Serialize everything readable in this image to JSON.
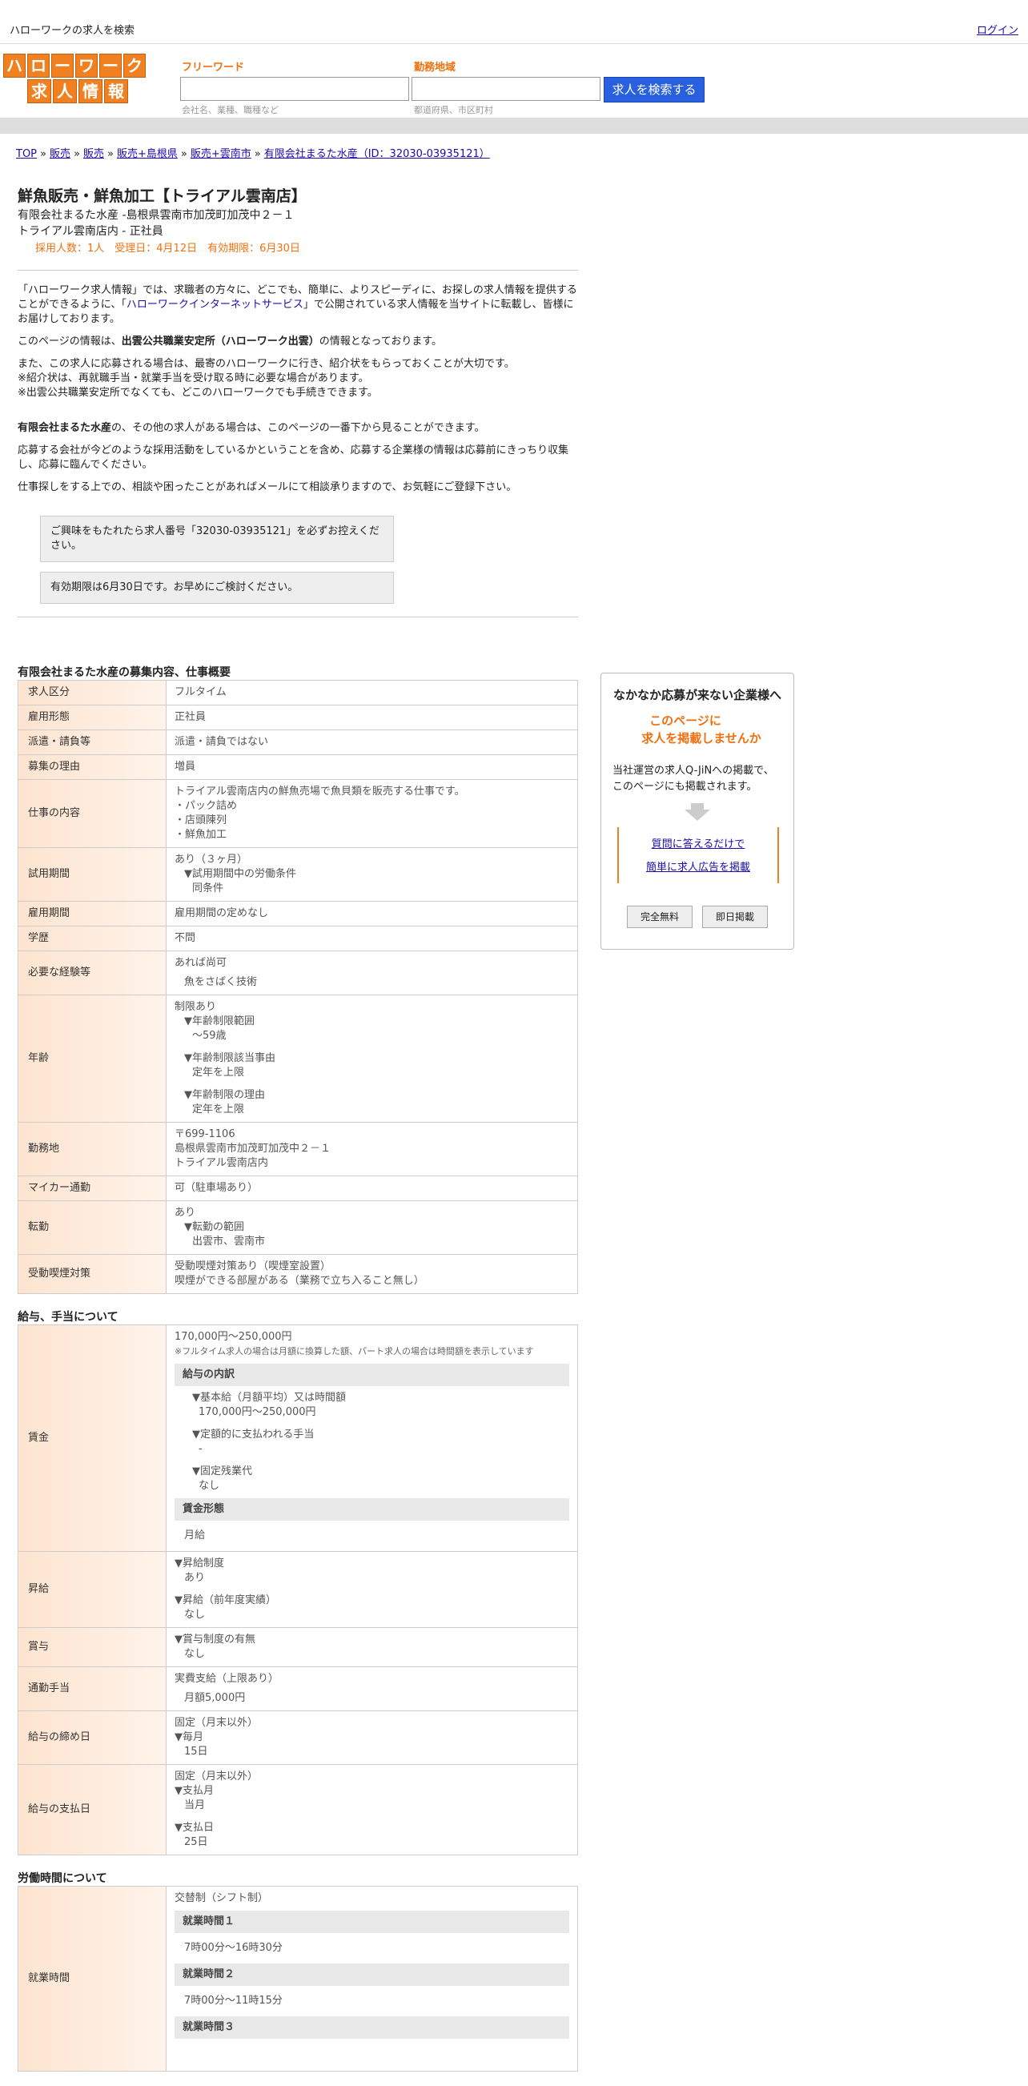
{
  "topbar": {
    "site_title": "ハローワークの求人を検索",
    "login": "ログイン"
  },
  "logo": {
    "row1": [
      "ハ",
      "ロ",
      "ー",
      "ワ",
      "ー",
      "ク"
    ],
    "row2": [
      "求",
      "人",
      "情",
      "報"
    ]
  },
  "search": {
    "freeword_label": "フリーワード",
    "freeword_hint": "会社名、業種、職種など",
    "area_label": "勤務地域",
    "area_hint": "都道府県、市区町村",
    "button": "求人を検索する"
  },
  "breadcrumb": [
    "TOP",
    "販売",
    "販売",
    "販売+島根県",
    "販売+雲南市",
    "有限会社まるた水産（ID：32030-03935121）"
  ],
  "job": {
    "title": "鮮魚販売・鮮魚加工【トライアル雲南店】",
    "company_line": "有限会社まるた水産 -島根県雲南市加茂町加茂中２－１",
    "store_line": "トライアル雲南店内 - 正社員",
    "meta": "採用人数：1人　受理日：4月12日　有効期限：6月30日"
  },
  "intro": {
    "p1a": "「ハローワーク求人情報」では、求職者の方々に、どこでも、簡単に、よりスピーディに、お探しの求人情報を提供することができるように、「",
    "p1_link": "ハローワークインターネットサービス",
    "p1b": "」で公開されている求人情報を当サイトに転載し、皆様にお届けしております。",
    "p2a": "このページの情報は、",
    "p2_bold": "出雲公共職業安定所（ハローワーク出雲）",
    "p2b": "の情報となっております。",
    "p3_1": "また、この求人に応募される場合は、最寄のハローワークに行き、紹介状をもらっておくことが大切です。",
    "p3_2": "※紹介状は、再就職手当・就業手当を受け取る時に必要な場合があります。",
    "p3_3": "※出雲公共職業安定所でなくても、どこのハローワークでも手続きできます。",
    "p4_bold": "有限会社まるた水産",
    "p4": "の、その他の求人がある場合は、このページの一番下から見ることができます。",
    "p5": "応募する会社が今どのような採用活動をしているかということを含め、応募する企業様の情報は応募前にきっちり収集し、応募に臨んでください。",
    "p6": "仕事探しをする上での、相談や困ったことがあればメールにて相談承りますので、お気軽にご登録下さい。",
    "notice1": "ご興味をもたれたら求人番号「32030-03935121」を必ずお控えください。",
    "notice2": "有効期限は6月30日です。お早めにご検討ください。"
  },
  "sec1": {
    "title": "有限会社まるた水産の募集内容、仕事概要",
    "kubun": {
      "h": "求人区分",
      "v": "フルタイム"
    },
    "koyou": {
      "h": "雇用形態",
      "v": "正社員"
    },
    "haken": {
      "h": "派遣・請負等",
      "v": "派遣・請負ではない"
    },
    "riyuu": {
      "h": "募集の理由",
      "v": "増員"
    },
    "shigoto": {
      "h": "仕事の内容",
      "l1": "トライアル雲南店内の鮮魚売場で魚貝類を販売する仕事です。",
      "l2": "・パック詰め",
      "l3": "・店頭陳列",
      "l4": "・鮮魚加工"
    },
    "shiyou": {
      "h": "試用期間",
      "l1": "あり（３ヶ月）",
      "l2": "▼試用期間中の労働条件",
      "l3": "同条件"
    },
    "kikan": {
      "h": "雇用期間",
      "v": "雇用期間の定めなし"
    },
    "gakureki": {
      "h": "学歴",
      "v": "不問"
    },
    "keiken": {
      "h": "必要な経験等",
      "l1": "あれば尚可",
      "l2": "魚をさばく技術"
    },
    "nenrei": {
      "h": "年齢",
      "l1": "制限あり",
      "l2": "▼年齢制限範囲",
      "l3": "〜59歳",
      "l4": "▼年齢制限該当事由",
      "l5": "定年を上限",
      "l6": "▼年齢制限の理由",
      "l7": "定年を上限"
    },
    "kinmuchi": {
      "h": "勤務地",
      "l1": "〒699-1106",
      "l2": "島根県雲南市加茂町加茂中２－１",
      "l3": "トライアル雲南店内"
    },
    "mycar": {
      "h": "マイカー通勤",
      "v": "可（駐車場あり）"
    },
    "tenkin": {
      "h": "転勤",
      "l1": "あり",
      "l2": "▼転勤の範囲",
      "l3": "出雲市、雲南市"
    },
    "judou": {
      "h": "受動喫煙対策",
      "l1": "受動喫煙対策あり（喫煙室設置）",
      "l2": "喫煙ができる部屋がある（業務で立ち入ること無し）"
    }
  },
  "sec2": {
    "title": "給与、手当について",
    "chingin": {
      "h": "賃金",
      "l1": "170,000円〜250,000円",
      "note": "※フルタイム求人の場合は月額に換算した額、パート求人の場合は時間額を表示しています",
      "sub1": "給与の内訳",
      "a1": "▼基本給（月額平均）又は時間額",
      "a2": "170,000円〜250,000円",
      "a3": "▼定額的に支払われる手当",
      "a4": "-",
      "a5": "▼固定残業代",
      "a6": "なし",
      "sub2": "賃金形態",
      "a7": "月給"
    },
    "shoukyu": {
      "h": "昇給",
      "l1": "▼昇給制度",
      "l2": "あり",
      "l3": "▼昇給（前年度実績）",
      "l4": "なし"
    },
    "shouyo": {
      "h": "賞与",
      "l1": "▼賞与制度の有無",
      "l2": "なし"
    },
    "tsukin": {
      "h": "通勤手当",
      "l1": "実費支給（上限あり）",
      "l2": "月額5,000円"
    },
    "shime": {
      "h": "給与の締め日",
      "l1": "固定（月末以外）",
      "l2": "▼毎月",
      "l3": "15日"
    },
    "shiharai": {
      "h": "給与の支払日",
      "l1": "固定（月末以外）",
      "l2": "▼支払月",
      "l3": "当月",
      "l4": "▼支払日",
      "l5": "25日"
    }
  },
  "sec3": {
    "title": "労働時間について",
    "shugyou": {
      "h": "就業時間",
      "l1": "交替制（シフト制）",
      "s1": "就業時間１",
      "t1": "7時00分〜16時30分",
      "s2": "就業時間２",
      "t2": "7時00分〜11時15分",
      "s3": "就業時間３"
    }
  },
  "side": {
    "t1": "なかなか応募が来ない企業様へ",
    "t2a": "このページに",
    "t2b": "求人を掲載しませんか",
    "t3a": "当社運営の求人Q-JiNへの掲載で、",
    "t3b": "このページにも掲載されます。",
    "link1": "質問に答えるだけで",
    "link2": "簡単に求人広告を掲載",
    "btn1": "完全無料",
    "btn2": "即日掲載"
  }
}
